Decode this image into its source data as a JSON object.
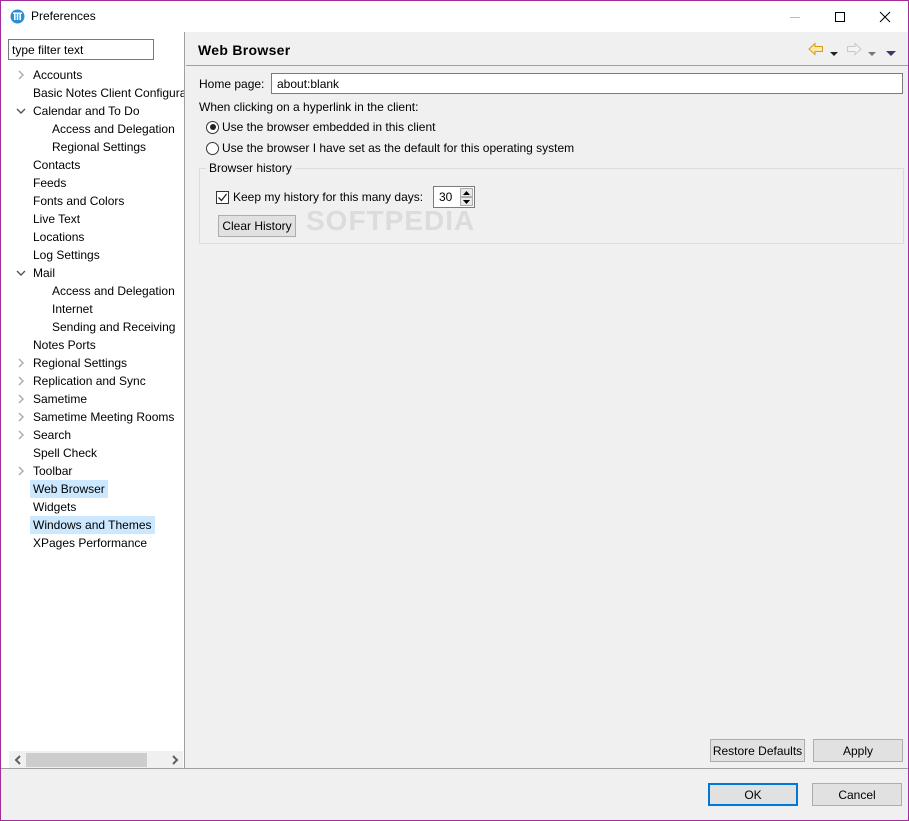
{
  "window": {
    "title": "Preferences",
    "icon": "notes-app-icon",
    "controls": {
      "minimize": "minimize-icon",
      "maximize": "maximize-icon",
      "close": "close-icon"
    }
  },
  "sidebar": {
    "filter_placeholder": "type filter text",
    "filter_value": "type filter text",
    "items": [
      {
        "label": "Accounts",
        "level": 0,
        "twisty": "collapsed",
        "selected": false
      },
      {
        "label": "Basic Notes Client Configuration",
        "level": 0,
        "twisty": "none",
        "selected": false
      },
      {
        "label": "Calendar and To Do",
        "level": 0,
        "twisty": "expanded",
        "selected": false
      },
      {
        "label": "Access and Delegation",
        "level": 1,
        "twisty": "none",
        "selected": false
      },
      {
        "label": "Regional Settings",
        "level": 1,
        "twisty": "none",
        "selected": false
      },
      {
        "label": "Contacts",
        "level": 0,
        "twisty": "none",
        "selected": false
      },
      {
        "label": "Feeds",
        "level": 0,
        "twisty": "none",
        "selected": false
      },
      {
        "label": "Fonts and Colors",
        "level": 0,
        "twisty": "none",
        "selected": false
      },
      {
        "label": "Live Text",
        "level": 0,
        "twisty": "none",
        "selected": false
      },
      {
        "label": "Locations",
        "level": 0,
        "twisty": "none",
        "selected": false
      },
      {
        "label": "Log Settings",
        "level": 0,
        "twisty": "none",
        "selected": false
      },
      {
        "label": "Mail",
        "level": 0,
        "twisty": "expanded",
        "selected": false
      },
      {
        "label": "Access and Delegation",
        "level": 1,
        "twisty": "none",
        "selected": false
      },
      {
        "label": "Internet",
        "level": 1,
        "twisty": "none",
        "selected": false
      },
      {
        "label": "Sending and Receiving",
        "level": 1,
        "twisty": "none",
        "selected": false
      },
      {
        "label": "Notes Ports",
        "level": 0,
        "twisty": "none",
        "selected": false
      },
      {
        "label": "Regional Settings",
        "level": 0,
        "twisty": "collapsed",
        "selected": false
      },
      {
        "label": "Replication and Sync",
        "level": 0,
        "twisty": "collapsed",
        "selected": false
      },
      {
        "label": "Sametime",
        "level": 0,
        "twisty": "collapsed",
        "selected": false
      },
      {
        "label": "Sametime Meeting Rooms",
        "level": 0,
        "twisty": "collapsed",
        "selected": false
      },
      {
        "label": "Search",
        "level": 0,
        "twisty": "collapsed",
        "selected": false
      },
      {
        "label": "Spell Check",
        "level": 0,
        "twisty": "none",
        "selected": false
      },
      {
        "label": "Toolbar",
        "level": 0,
        "twisty": "collapsed",
        "selected": false
      },
      {
        "label": "Web Browser",
        "level": 0,
        "twisty": "none",
        "selected": true
      },
      {
        "label": "Widgets",
        "level": 0,
        "twisty": "none",
        "selected": false
      },
      {
        "label": "Windows and Themes",
        "level": 0,
        "twisty": "none",
        "selected": true
      },
      {
        "label": "XPages Performance",
        "level": 0,
        "twisty": "none",
        "selected": false
      }
    ]
  },
  "page": {
    "title": "Web Browser",
    "nav": {
      "back": "back-arrow-icon",
      "forward": "forward-arrow-icon",
      "menu": "view-menu-icon"
    },
    "home_page_label": "Home page:",
    "home_page_value": "about:blank",
    "hyperlink_label": "When clicking on a hyperlink in the client:",
    "radio_options": [
      {
        "label": "Use the browser embedded in this client",
        "checked": true
      },
      {
        "label": "Use the browser I have set as the default for this operating system",
        "checked": false
      }
    ],
    "history_group": {
      "title": "Browser history",
      "keep_label": "Keep my history for this many days:",
      "keep_checked": true,
      "days_value": "30",
      "clear_button": "Clear History"
    },
    "watermark": "SOFTPEDIA",
    "restore_defaults": "Restore Defaults",
    "apply": "Apply"
  },
  "footer": {
    "ok": "OK",
    "cancel": "Cancel"
  }
}
